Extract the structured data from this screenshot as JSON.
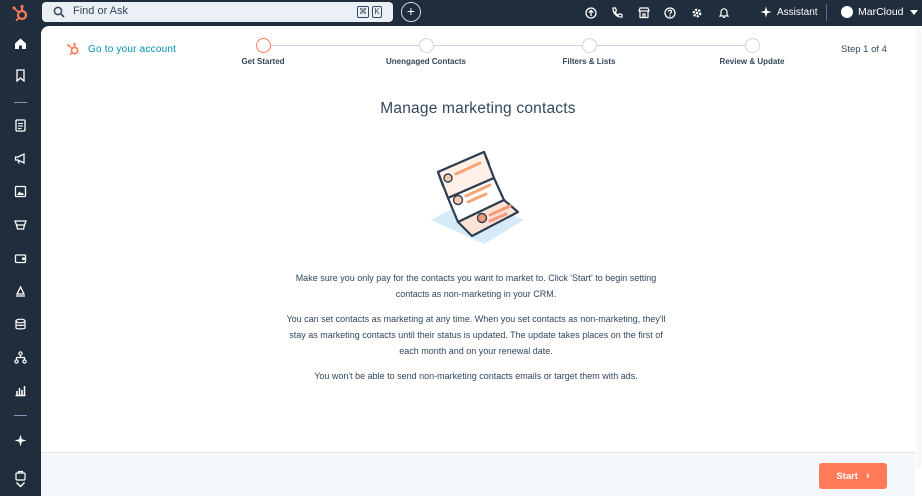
{
  "topbar": {
    "search_placeholder": "Find or Ask",
    "shortcut_key1": "⌘",
    "shortcut_key2": "K",
    "plus_label": "+",
    "assistant_label": "Assistant",
    "account_name": "MarCloud"
  },
  "leftnav": {
    "items": [
      "home-icon",
      "bookmark-icon",
      "contacts-icon",
      "marketing-icon",
      "content-icon",
      "commerce-icon",
      "service-icon",
      "automation-icon",
      "data-icon",
      "reporting-icon",
      "sparkle-icon",
      "apps-icon",
      "collapse-icon"
    ]
  },
  "header": {
    "go_to_account": "Go to your account",
    "step_count": "Step 1 of 4",
    "steps": [
      {
        "label": "Get Started",
        "active": true
      },
      {
        "label": "Unengaged Contacts",
        "active": false
      },
      {
        "label": "Filters & Lists",
        "active": false
      },
      {
        "label": "Review & Update",
        "active": false
      }
    ]
  },
  "main": {
    "title": "Manage marketing contacts",
    "paragraphs": [
      "Make sure you only pay for the contacts you want to market to. Click 'Start' to begin setting contacts as non-marketing in your CRM.",
      "You can set contacts as marketing at any time. When you set contacts as non-marketing, they'll stay as marketing contacts until their status is updated. The update takes places on the first of each month and on your renewal date.",
      "You won't be able to send non-marketing contacts emails or target them with ads."
    ]
  },
  "footer": {
    "start_label": "Start",
    "start_chevron": "›"
  },
  "colors": {
    "accent": "#ff7a59",
    "link": "#0091ae",
    "nav_bg": "#1f2d3d",
    "text": "#33475b"
  }
}
